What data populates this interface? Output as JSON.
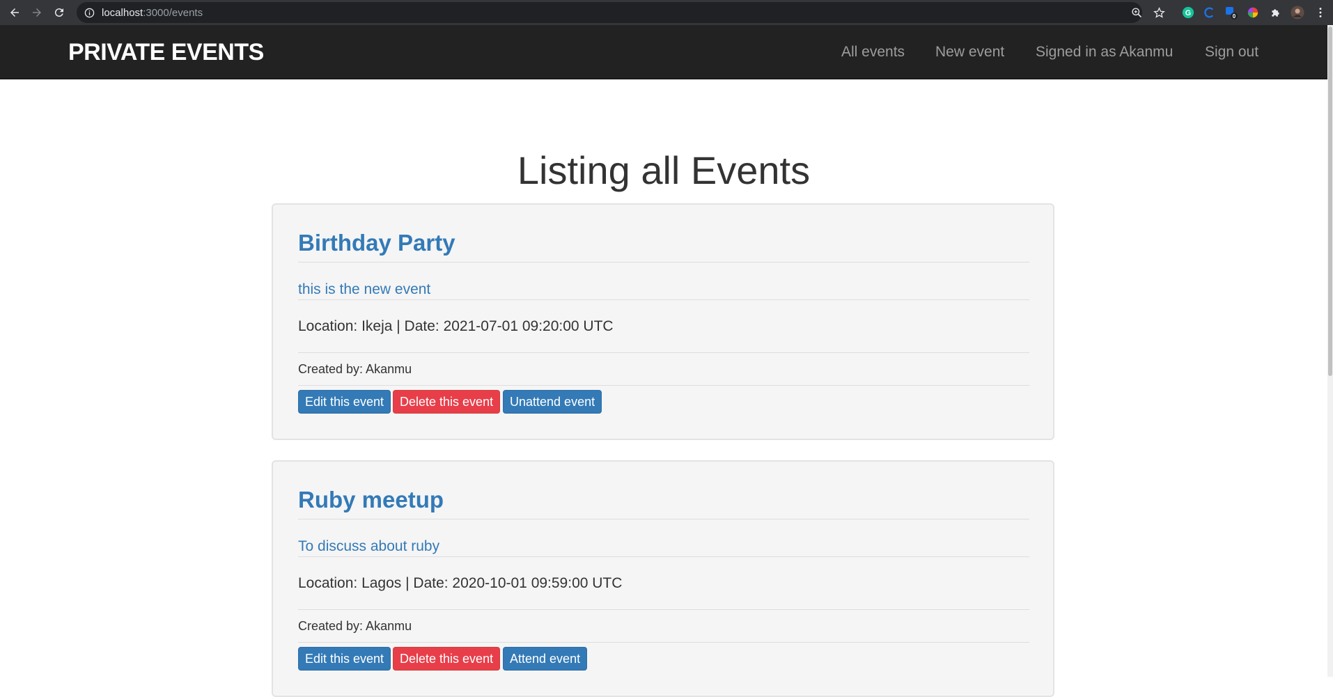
{
  "browser": {
    "url_host": "localhost",
    "url_path": ":3000/events",
    "extension_badge": "0"
  },
  "navbar": {
    "brand": "PRIVATE EVENTS",
    "links": [
      {
        "label": "All events"
      },
      {
        "label": "New event"
      },
      {
        "label": "Signed in as Akanmu"
      },
      {
        "label": "Sign out"
      }
    ]
  },
  "main": {
    "title": "Listing all Events",
    "events": [
      {
        "title": "Birthday Party",
        "description": "this is the new event",
        "meta": "Location: Ikeja | Date: 2021-07-01 09:20:00 UTC",
        "creator": "Created by: Akanmu",
        "edit_label": "Edit this event",
        "delete_label": "Delete this event",
        "attend_label": "Unattend event"
      },
      {
        "title": "Ruby meetup",
        "description": "To discuss about ruby",
        "meta": "Location: Lagos | Date: 2020-10-01 09:59:00 UTC",
        "creator": "Created by: Akanmu",
        "edit_label": "Edit this event",
        "delete_label": "Delete this event",
        "attend_label": "Attend event"
      }
    ]
  },
  "colors": {
    "navbar_bg": "#222222",
    "link_blue": "#337ab7",
    "danger_red": "#e83e4a",
    "card_bg": "#f5f5f5"
  }
}
